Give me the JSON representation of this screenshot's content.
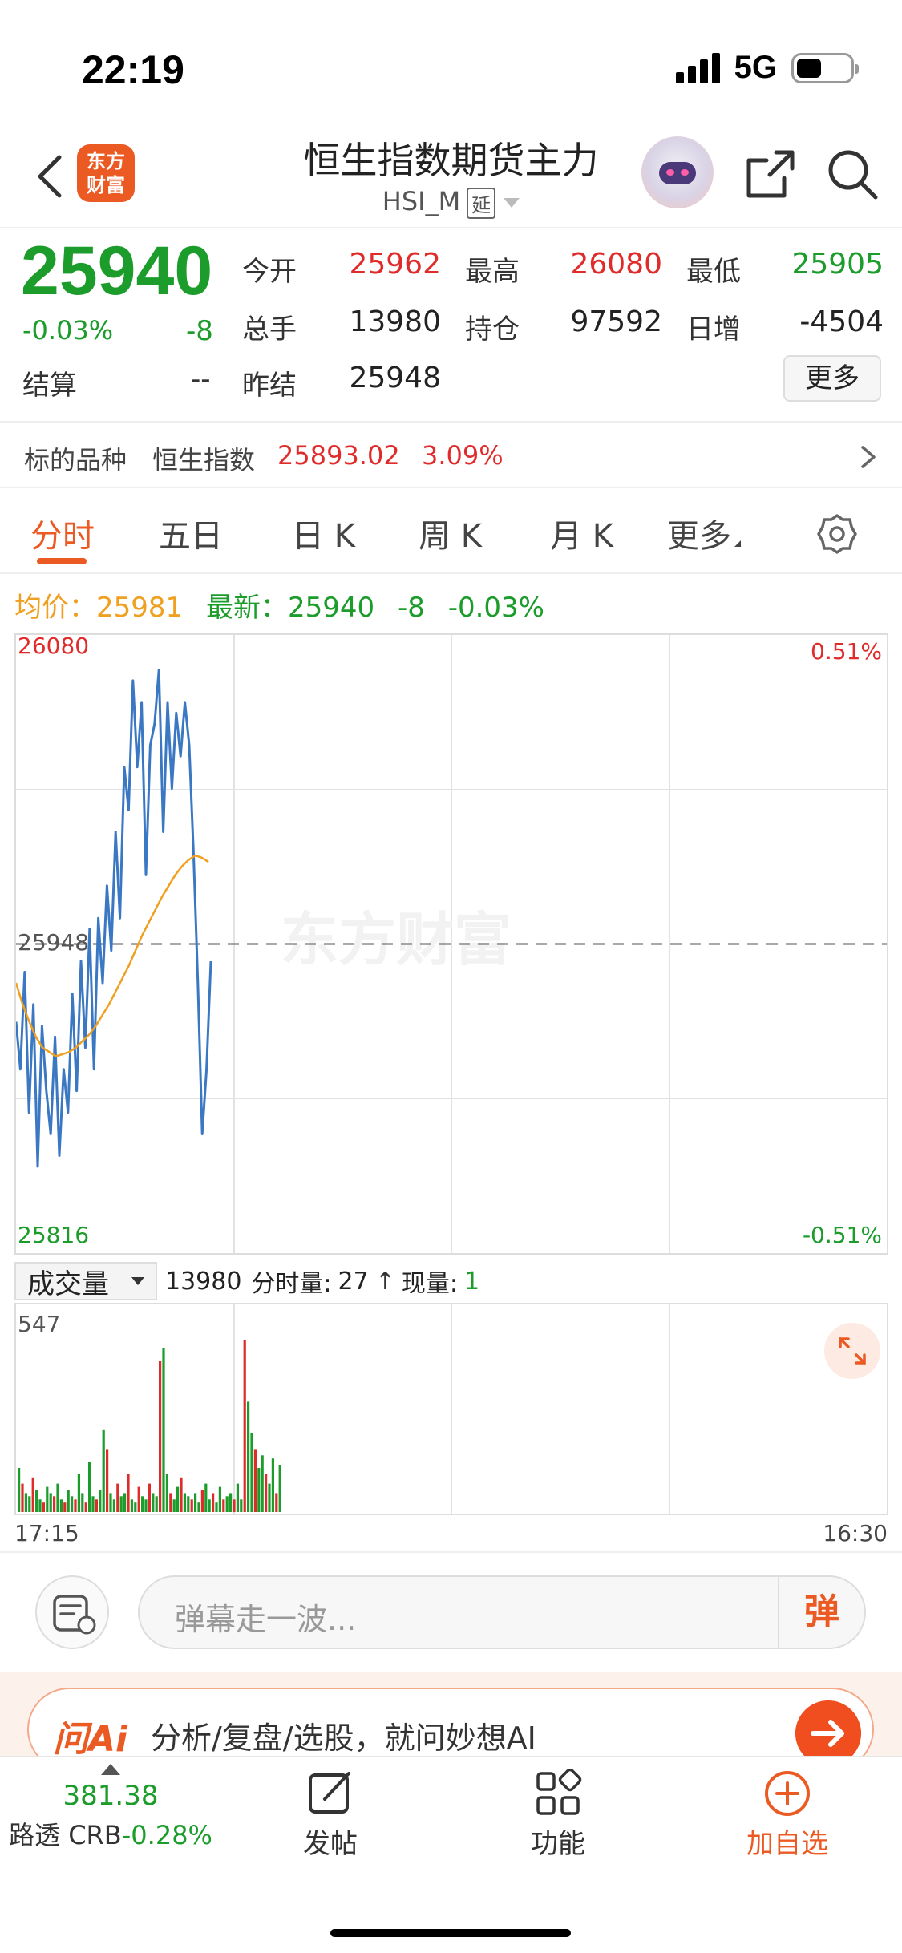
{
  "status_bar": {
    "time": "22:19",
    "network": "5G"
  },
  "nav": {
    "logo_text": [
      "东方",
      "财富"
    ],
    "title": "恒生指数期货主力",
    "subtitle": "HSI_M",
    "delay_tag": "延"
  },
  "quote": {
    "price": "25940",
    "change_pct": "-0.03%",
    "change": "-8",
    "settle_label": "结算",
    "settle_value": "--",
    "fields": [
      {
        "label": "今开",
        "value": "25962",
        "color": "red"
      },
      {
        "label": "最高",
        "value": "26080",
        "color": "red"
      },
      {
        "label": "最低",
        "value": "25905",
        "color": "green"
      },
      {
        "label": "总手",
        "value": "13980",
        "color": "dark"
      },
      {
        "label": "持仓",
        "value": "97592",
        "color": "dark"
      },
      {
        "label": "日增",
        "value": "-4504",
        "color": "dark"
      },
      {
        "label": "昨结",
        "value": "25948",
        "color": "dark"
      }
    ],
    "more_button": "更多"
  },
  "underlying": {
    "label": "标的品种",
    "name": "恒生指数",
    "value": "25893.02",
    "pct": "3.09%"
  },
  "tabs": [
    {
      "label": "分时",
      "active": true
    },
    {
      "label": "五日",
      "active": false
    },
    {
      "label": "日 K",
      "active": false
    },
    {
      "label": "周 K",
      "active": false
    },
    {
      "label": "月 K",
      "active": false
    },
    {
      "label": "更多",
      "active": false
    }
  ],
  "info_row": {
    "avg_label": "均价：",
    "avg_value": "25981",
    "latest_label": "最新：",
    "latest_value": "25940",
    "latest_change": "-8",
    "latest_pct": "-0.03%"
  },
  "chart_labels": {
    "top_price": "26080",
    "bottom_price": "25816",
    "mid_price": "25948",
    "top_pct": "0.51%",
    "bottom_pct": "-0.51%",
    "watermark": "东方财富"
  },
  "volume_bar": {
    "selector": "成交量",
    "total": "13980",
    "period_label": "分时量:",
    "period_value": "27",
    "now_label": "现量:",
    "now_value": "1",
    "max_label": "547",
    "time_start": "17:15",
    "time_end": "16:30"
  },
  "comment": {
    "placeholder": "弹幕走一波...",
    "danmu_label": "弹"
  },
  "ai_bar": {
    "logo": "问Ai",
    "text": "分析/复盘/选股，就问妙想AI"
  },
  "tabbar": {
    "ticker_value": "381.38",
    "ticker_label": "路透 CRB",
    "ticker_pct": "-0.28%",
    "post_label": "发帖",
    "function_label": "功能",
    "watch_label": "加自选"
  },
  "colors": {
    "accent": "#ec5a23",
    "up": "#e02b2b",
    "down": "#1b9c2b",
    "price_line": "#3b78c3",
    "avg_line": "#f0a020"
  },
  "chart_data": {
    "type": "line",
    "ylim": [
      25816,
      26080
    ],
    "baseline": 25948,
    "series": [
      {
        "values": [
          25912,
          25890,
          25935,
          25870,
          25920,
          25845,
          25910,
          25880,
          25860,
          25905,
          25850,
          25890,
          25870,
          25925,
          25880,
          25940,
          25900,
          25955,
          25890,
          25960,
          25930,
          25975,
          25945,
          26000,
          25960,
          26030,
          26010,
          26070,
          26030,
          26060,
          25980,
          26040,
          26050,
          26075,
          26000,
          26060,
          26020,
          26055,
          26035,
          26060,
          26040,
          25990,
          25930,
          25860,
          25890,
          25940
        ]
      },
      {
        "values": [
          25930,
          25920,
          25912,
          25905,
          25900,
          25898,
          25896,
          25897,
          25898,
          25900,
          25903,
          25906,
          25910,
          25915,
          25920,
          25926,
          25932,
          25938,
          25945,
          25952,
          25958,
          25964,
          25970,
          25975,
          25980,
          25984,
          25987,
          25989,
          25988,
          25986
        ]
      }
    ],
    "volume": {
      "max": 547,
      "values": [
        140,
        90,
        60,
        50,
        110,
        70,
        40,
        30,
        80,
        60,
        50,
        90,
        40,
        30,
        70,
        50,
        40,
        120,
        60,
        30,
        160,
        50,
        40,
        70,
        260,
        200,
        60,
        40,
        90,
        50,
        60,
        120,
        40,
        30,
        80,
        50,
        40,
        90,
        60,
        50,
        480,
        520,
        120,
        60,
        40,
        80,
        110,
        60,
        50,
        40,
        60,
        30,
        70,
        90,
        40,
        60,
        30,
        80,
        40,
        50,
        60,
        40,
        90,
        40,
        547,
        350,
        250,
        200,
        140,
        180,
        120,
        90,
        170,
        60,
        150
      ]
    }
  }
}
